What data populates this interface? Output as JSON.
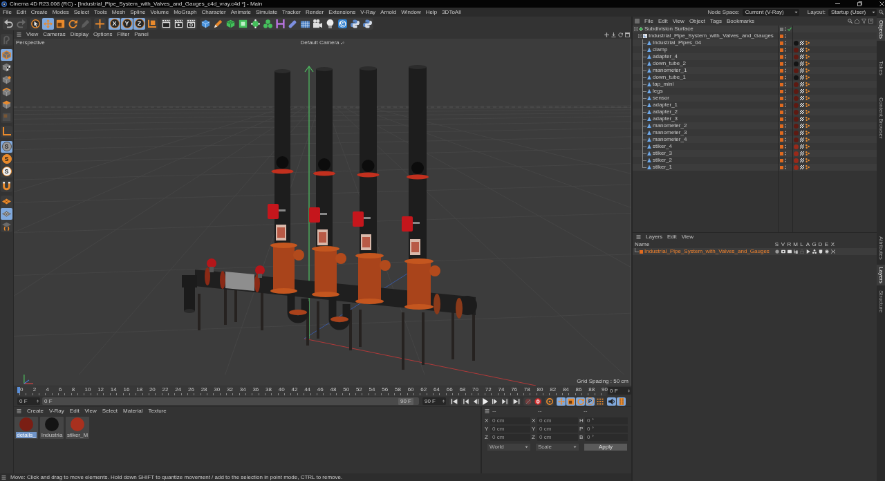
{
  "window": {
    "title": "Cinema 4D R23.008 (RC) - [Industrial_Pipe_System_with_Valves_and_Gauges_c4d_vray.c4d *] - Main"
  },
  "menu": [
    "File",
    "Edit",
    "Create",
    "Modes",
    "Select",
    "Tools",
    "Mesh",
    "Spline",
    "Volume",
    "MoGraph",
    "Character",
    "Animate",
    "Simulate",
    "Tracker",
    "Render",
    "Extensions",
    "V-Ray",
    "Arnold",
    "Window",
    "Help",
    "3DToAll"
  ],
  "node_space": {
    "label": "Node Space:",
    "value": "Current (V-Ray)"
  },
  "layout": {
    "label": "Layout:",
    "value": "Startup (User)"
  },
  "toolbar": [
    {
      "selected": false,
      "disabled": false
    },
    {
      "selected": false,
      "disabled": true
    },
    {
      "selected": false,
      "disabled": false
    },
    {
      "selected": true,
      "disabled": false
    },
    {
      "selected": false,
      "disabled": false
    },
    {
      "selected": false,
      "disabled": false
    },
    {
      "selected": false,
      "disabled": true
    },
    {
      "selected": false,
      "disabled": false
    },
    {
      "label": "X",
      "selected": true,
      "disabled": false
    },
    {
      "label": "Y",
      "selected": true,
      "disabled": false
    },
    {
      "label": "Z",
      "selected": true,
      "disabled": false
    },
    {
      "selected": false,
      "disabled": false
    },
    {
      "selected": false,
      "disabled": false
    },
    {
      "selected": false,
      "disabled": false
    },
    {
      "selected": false,
      "disabled": false
    },
    {
      "selected": false,
      "disabled": false
    },
    {
      "selected": false,
      "disabled": false
    },
    {
      "selected": false,
      "disabled": false
    },
    {
      "selected": false,
      "disabled": false
    },
    {
      "selected": false,
      "disabled": false
    },
    {
      "selected": false,
      "disabled": false
    },
    {
      "selected": false,
      "disabled": false
    },
    {
      "selected": false,
      "disabled": false
    },
    {
      "selected": false,
      "disabled": false
    },
    {
      "selected": false,
      "disabled": false
    },
    {
      "selected": false,
      "disabled": false
    },
    {
      "selected": false,
      "disabled": false
    },
    {
      "selected": false,
      "disabled": false
    },
    {
      "selected": false,
      "disabled": false
    }
  ],
  "tool_palette": [
    {
      "selected": false,
      "disabled": true
    },
    {
      "selected": true,
      "disabled": false
    },
    {
      "selected": false,
      "disabled": false
    },
    {
      "selected": false,
      "disabled": false
    },
    {
      "selected": false,
      "disabled": false
    },
    {
      "selected": false,
      "disabled": false
    },
    {
      "selected": false,
      "disabled": true
    },
    {
      "selected": false,
      "disabled": false
    },
    {
      "label": "S",
      "selected": true,
      "disabled": false
    },
    {
      "label": "S",
      "selected": false,
      "disabled": false
    },
    {
      "label": "S",
      "selected": false,
      "disabled": false
    },
    {
      "selected": false,
      "disabled": false
    },
    {
      "selected": false,
      "disabled": false
    },
    {
      "selected": true,
      "disabled": false
    },
    {
      "selected": false,
      "disabled": false
    }
  ],
  "viewport": {
    "menu": [
      "View",
      "Cameras",
      "Display",
      "Options",
      "Filter",
      "Panel"
    ],
    "view_name": "Perspective",
    "camera": "Default Camera",
    "grid_spacing": "Grid Spacing : 50 cm"
  },
  "timeline": {
    "ticks": [
      "0",
      "2",
      "4",
      "6",
      "8",
      "10",
      "12",
      "14",
      "16",
      "18",
      "20",
      "22",
      "24",
      "26",
      "28",
      "30",
      "32",
      "34",
      "36",
      "38",
      "40",
      "42",
      "44",
      "46",
      "48",
      "50",
      "52",
      "54",
      "56",
      "58",
      "60",
      "62",
      "64",
      "66",
      "68",
      "70",
      "72",
      "74",
      "76",
      "78",
      "80",
      "82",
      "84",
      "86",
      "88",
      "90"
    ],
    "playhead": {
      "level": 0
    },
    "current_frame": "0 F",
    "start_field": "0 F",
    "range_start": "0 F",
    "range_end": "90 F",
    "end_field": "90 F",
    "controls": [
      {
        "selected": false,
        "disabled": false
      },
      {
        "selected": false,
        "disabled": false
      },
      {
        "selected": false,
        "disabled": false
      },
      {
        "selected": false,
        "disabled": false
      },
      {
        "selected": false,
        "disabled": false
      },
      {
        "selected": false,
        "disabled": false
      },
      {
        "selected": false,
        "disabled": false
      },
      {
        "selected": false,
        "disabled": true
      },
      {
        "selected": false,
        "disabled": false
      },
      {
        "selected": false,
        "disabled": false
      },
      {
        "selected": true,
        "disabled": false
      },
      {
        "selected": true,
        "disabled": false
      },
      {
        "selected": true,
        "disabled": false
      },
      {
        "label": "P",
        "selected": true,
        "disabled": false
      },
      {
        "selected": false,
        "disabled": false
      },
      {
        "selected": true,
        "disabled": false
      },
      {
        "selected": true,
        "disabled": false
      }
    ]
  },
  "material_manager": {
    "menu": [
      "Create",
      "V-Ray",
      "Edit",
      "View",
      "Select",
      "Material",
      "Texture"
    ],
    "materials": [
      {
        "name": "details_",
        "selected": true,
        "color": "#7a1e14"
      },
      {
        "name": "Industria",
        "selected": false,
        "color": "#141414"
      },
      {
        "name": "stiker_M",
        "selected": false,
        "color": "#a8301e"
      }
    ]
  },
  "coordinates": {
    "columns": [
      "--",
      "--",
      "--"
    ],
    "rows": [
      {
        "position_axis": "X",
        "position": "0 cm",
        "size_axis": "X",
        "size": "0 cm",
        "rotation_axis": "H",
        "rotation": "0 °"
      },
      {
        "position_axis": "Y",
        "position": "0 cm",
        "size_axis": "Y",
        "size": "0 cm",
        "rotation_axis": "P",
        "rotation": "0 °"
      },
      {
        "position_axis": "Z",
        "position": "0 cm",
        "size_axis": "Z",
        "size": "0 cm",
        "rotation_axis": "B",
        "rotation": "0 °"
      }
    ],
    "mode": "World",
    "size_mode": "Scale",
    "apply": "Apply"
  },
  "status_bar": {
    "text": "Move: Click and drag to move elements. Hold down SHIFT to quantize movement / add to the selection in point mode, CTRL to remove."
  },
  "object_manager": {
    "menu": [
      "File",
      "Edit",
      "View",
      "Object",
      "Tags",
      "Bookmarks"
    ],
    "tree": [
      {
        "name": "Subdivision Surface",
        "kind": "subdivision",
        "in_layer": false,
        "enabled": true,
        "expanded": true,
        "children": [
          {
            "name": "Industrial_Pipe_System_with_Valves_and_Gauges",
            "kind": "null",
            "in_layer": true,
            "expanded": true,
            "children": [
              {
                "name": "Industrial_Pipes_04",
                "kind": "polygon",
                "in_layer": true,
                "color": "#141414"
              },
              {
                "name": "clamp",
                "kind": "polygon",
                "in_layer": true,
                "color": "#5e1a12"
              },
              {
                "name": "adapter_4",
                "kind": "polygon",
                "in_layer": true,
                "color": "#5e1a12"
              },
              {
                "name": "down_tube_2",
                "kind": "polygon",
                "in_layer": true,
                "color": "#141414"
              },
              {
                "name": "manometer_1",
                "kind": "polygon",
                "in_layer": true,
                "color": "#5e1a12"
              },
              {
                "name": "down_tube_1",
                "kind": "polygon",
                "in_layer": true,
                "color": "#141414"
              },
              {
                "name": "tap_mini",
                "kind": "polygon",
                "in_layer": true,
                "color": "#5e1a12"
              },
              {
                "name": "legs",
                "kind": "polygon",
                "in_layer": true,
                "color": "#5e1a12"
              },
              {
                "name": "sensor",
                "kind": "polygon",
                "in_layer": true,
                "color": "#5e1a12"
              },
              {
                "name": "adapter_1",
                "kind": "polygon",
                "in_layer": true,
                "color": "#5e1a12"
              },
              {
                "name": "adapter_2",
                "kind": "polygon",
                "in_layer": true,
                "color": "#5e1a12"
              },
              {
                "name": "adapter_3",
                "kind": "polygon",
                "in_layer": true,
                "color": "#5e1a12"
              },
              {
                "name": "manometer_2",
                "kind": "polygon",
                "in_layer": true,
                "color": "#5e1a12"
              },
              {
                "name": "manometer_3",
                "kind": "polygon",
                "in_layer": true,
                "color": "#5e1a12"
              },
              {
                "name": "manometer_4",
                "kind": "polygon",
                "in_layer": true,
                "color": "#5e1a12"
              },
              {
                "name": "stiker_4",
                "kind": "polygon",
                "in_layer": true,
                "color": "#9a2a1a"
              },
              {
                "name": "stiker_3",
                "kind": "polygon",
                "in_layer": true,
                "color": "#9a2a1a"
              },
              {
                "name": "stiker_2",
                "kind": "polygon",
                "in_layer": true,
                "color": "#9a2a1a"
              },
              {
                "name": "stiker_1",
                "kind": "polygon",
                "in_layer": true,
                "color": "#9a2a1a"
              }
            ]
          }
        ]
      }
    ]
  },
  "layer_manager": {
    "menu": [
      "Layers",
      "Edit",
      "View"
    ],
    "name_header": "Name",
    "flag_columns": [
      "S",
      "V",
      "R",
      "M",
      "L",
      "A",
      "G",
      "D",
      "E",
      "X"
    ],
    "layers": [
      {
        "name": "Industrial_Pipe_System_with_Valves_and_Gauges"
      }
    ]
  },
  "side_tabs": {
    "top": [
      {
        "label": "Objects",
        "selected": true
      },
      {
        "label": "Takes",
        "selected": false
      },
      {
        "label": "Content Browser",
        "selected": false
      }
    ],
    "bottom": [
      {
        "label": "Attributes",
        "selected": false
      },
      {
        "label": "Layers",
        "selected": true
      },
      {
        "label": "Structure",
        "selected": false
      }
    ]
  }
}
